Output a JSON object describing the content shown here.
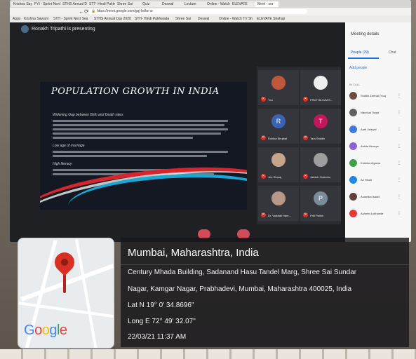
{
  "browser": {
    "tabs": [
      "Krishna Sayya",
      "FYI - Sprint Next Sea...",
      "STHS Annual Day",
      "STT- Hindi Pakhwada",
      "Shree Sai",
      "Quiz",
      "Deswal",
      "Lecture",
      "Online - Watch",
      "ELEVATE",
      "Meet - sor"
    ],
    "url": "https://meet.google.com/gqj-hdhz-ur",
    "bookmarks": [
      "Apps",
      "Krishna Sawant",
      "STH - Sprint Next Sea",
      "STHS Annual Day 2020",
      "STH- Hindi Pakhwada",
      "Shree Sai",
      "Deswal",
      "Online - Watch TV Sh",
      "ELEVATE Shahaji"
    ]
  },
  "meet": {
    "presenter_text": "Ronakh Tripathi is presenting",
    "slide": {
      "title": "POPULATION GROWTH IN INDIA",
      "headings": [
        "Widening Gap between Birth and Death rates",
        "Low age of marriage",
        "High literacy"
      ]
    },
    "tiles": [
      {
        "name": "You",
        "initial": "",
        "color": "#c0563a"
      },
      {
        "name": "PRUTHA KAVIS...",
        "initial": "",
        "color": "#efefef"
      },
      {
        "name": "Rohika Bhujbal",
        "initial": "R",
        "color": "#3b63b3"
      },
      {
        "name": "Tara Shaikh",
        "initial": "T",
        "color": "#c2185b"
      },
      {
        "name": "Jee Sharaj",
        "initial": "",
        "color": "#c7a58a"
      },
      {
        "name": "Jainish Gotecha",
        "initial": "",
        "color": "#9e9e9e"
      },
      {
        "name": "Dr. Vaishali Ham...",
        "initial": "",
        "color": "#b99786"
      },
      {
        "name": "Priti Parikh",
        "initial": "P",
        "color": "#7a8c9a"
      }
    ],
    "panel": {
      "title": "Meeting details",
      "tab_people": "People (29)",
      "tab_chat": "Chat",
      "add_people": "Add people",
      "in_call": "IN CALL",
      "people": [
        {
          "name": "Shaikh Zeenat (You)",
          "color": "#6d4c41"
        },
        {
          "name": "Nanchal Tiwari",
          "color": "#616161"
        },
        {
          "name": "Aarti Jaiswal",
          "color": "#3f7ad8"
        },
        {
          "name": "Ankita Mourya",
          "color": "#8e63d0"
        },
        {
          "name": "Krishika Ngama",
          "color": "#43a047"
        },
        {
          "name": "Ari Rikde",
          "color": "#1e88e5"
        },
        {
          "name": "Anamika Isaani",
          "color": "#5d4037"
        },
        {
          "name": "Ashwini Lokhande",
          "color": "#e53935"
        }
      ]
    }
  },
  "geo_tag": {
    "city": "Mumbai, Maharashtra, India",
    "address_line1": "Century Mhada Building, Sadanand Hasu Tandel Marg, Shree Sai Sundar",
    "address_line2": "Nagar, Kamgar Nagar, Prabhadevi, Mumbai, Maharashtra 400025, India",
    "lat": "Lat N 19° 0' 34.8696\"",
    "long": "Long E 72° 49' 32.07\"",
    "datetime": "22/03/21 11:37 AM",
    "map_logo": "Google"
  },
  "colors": {
    "pin": "#d93025",
    "meet_bg": "#1f2023",
    "panel_accent": "#1a73e8",
    "control_red": "#d14b5a"
  }
}
